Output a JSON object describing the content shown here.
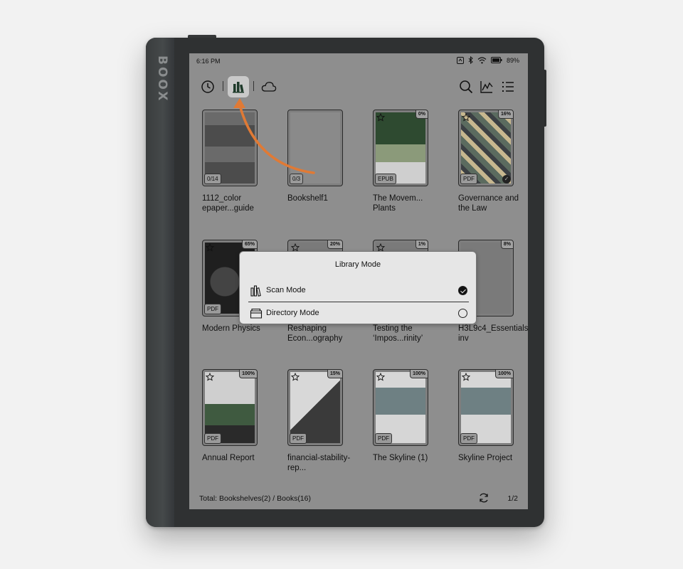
{
  "device": {
    "brand": "BOOX"
  },
  "status": {
    "time": "6:16 PM",
    "battery": "89%"
  },
  "toolbar": {
    "left": [
      "clock-icon",
      "bookshelf-icon",
      "cloud-icon"
    ],
    "right": [
      "search-icon",
      "stats-icon",
      "list-icon"
    ],
    "active": "bookshelf-icon"
  },
  "books": [
    {
      "title": "1112_color epaper...guide",
      "badge": "0/14",
      "pct": "",
      "star": false
    },
    {
      "title": "Bookshelf1",
      "badge": "0/3",
      "pct": "",
      "star": false
    },
    {
      "title": "The Movem... Plants",
      "badge": "EPUB",
      "pct": "0%",
      "star": true
    },
    {
      "title": "Governance and the Law",
      "badge": "PDF",
      "pct": "16%",
      "star": true,
      "done": true
    },
    {
      "title": "Modern Physics",
      "badge": "PDF",
      "pct": "65%",
      "star": true
    },
    {
      "title": "Reshaping Econ...ography",
      "badge": "",
      "pct": "20%",
      "star": true
    },
    {
      "title": "Testing the ‘Impos...rinity’",
      "badge": "",
      "pct": "1%",
      "star": true
    },
    {
      "title": "H3L9c4_Essentials-inv",
      "badge": "",
      "pct": "8%",
      "star": false
    },
    {
      "title": "Annual Report",
      "badge": "PDF",
      "pct": "100%",
      "star": true
    },
    {
      "title": "financial-stability-rep...",
      "badge": "PDF",
      "pct": "15%",
      "star": true
    },
    {
      "title": "The Skyline (1)",
      "badge": "PDF",
      "pct": "100%",
      "star": true
    },
    {
      "title": "Skyline Project",
      "badge": "PDF",
      "pct": "100%",
      "star": true
    }
  ],
  "dialog": {
    "title": "Library Mode",
    "options": [
      {
        "label": "Scan Mode",
        "selected": true
      },
      {
        "label": "Directory Mode",
        "selected": false
      }
    ]
  },
  "footer": {
    "total": "Total: Bookshelves(2) / Books(16)",
    "page": "1/2"
  },
  "colors": {
    "screen": "#8e8e8e",
    "arrow": "#e07a35",
    "device": "#2f3132"
  }
}
